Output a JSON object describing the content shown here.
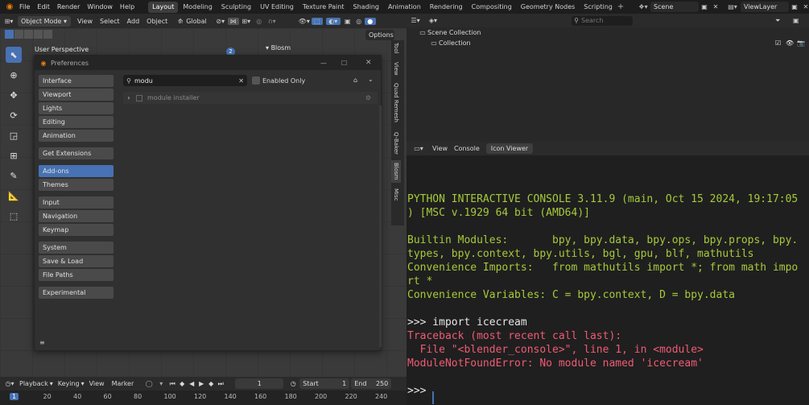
{
  "topbar": {
    "menus": [
      "File",
      "Edit",
      "Render",
      "Window",
      "Help"
    ],
    "workspaces": [
      "Layout",
      "Modeling",
      "Sculpting",
      "UV Editing",
      "Texture Paint",
      "Shading",
      "Animation",
      "Rendering",
      "Compositing",
      "Geometry Nodes",
      "Scripting"
    ],
    "scene": "Scene",
    "viewlayer": "ViewLayer"
  },
  "viewport": {
    "mode": "Object Mode",
    "menus": [
      "View",
      "Select",
      "Add",
      "Object"
    ],
    "orientation": "Global",
    "perspective": "User Perspective",
    "options": "Options",
    "blosm": "Blosm"
  },
  "prefs": {
    "title": "Preferences",
    "sidebar": [
      "Interface",
      "Viewport",
      "Lights",
      "Editing",
      "Animation",
      "Get Extensions",
      "Add-ons",
      "Themes",
      "Input",
      "Navigation",
      "Keymap",
      "System",
      "Save & Load",
      "File Paths",
      "Experimental"
    ],
    "active": "Add-ons",
    "search": "modu",
    "enabled_only": "Enabled Only",
    "addon": "module installer"
  },
  "sidetabs": [
    "Tool",
    "View",
    "Quad Remesh",
    "Q-Baker",
    "Blosm",
    "Misc"
  ],
  "timeline": {
    "playback": "Playback",
    "keying": "Keying",
    "view": "View",
    "marker": "Marker",
    "frame": "1",
    "start_label": "Start",
    "start": "1",
    "end_label": "End",
    "end": "250",
    "ticks": [
      "1",
      "20",
      "40",
      "60",
      "80",
      "100",
      "120",
      "140",
      "160",
      "180",
      "200",
      "220",
      "240"
    ]
  },
  "outliner": {
    "search_placeholder": "Search",
    "scene_collection": "Scene Collection",
    "collection": "Collection"
  },
  "console": {
    "menus": [
      "View",
      "Console"
    ],
    "tab": "Icon Viewer",
    "lines": [
      {
        "t": "PYTHON INTERACTIVE CONSOLE 3.11.9 (main, Oct 15 2024, 19:17:05",
        "c": "yel"
      },
      {
        "t": ") [MSC v.1929 64 bit (AMD64)]",
        "c": "yel"
      },
      {
        "t": "",
        "c": "yel"
      },
      {
        "t": "Builtin Modules:       bpy, bpy.data, bpy.ops, bpy.props, bpy.",
        "c": "yel"
      },
      {
        "t": "types, bpy.context, bpy.utils, bgl, gpu, blf, mathutils",
        "c": "yel"
      },
      {
        "t": "Convenience Imports:   from mathutils import *; from math impo",
        "c": "yel"
      },
      {
        "t": "rt *",
        "c": "yel"
      },
      {
        "t": "Convenience Variables: C = bpy.context, D = bpy.data",
        "c": "yel"
      },
      {
        "t": "",
        "c": "yel"
      },
      {
        "t": ">>> import icecream",
        "c": "wht"
      },
      {
        "t": "Traceback (most recent call last):",
        "c": "red"
      },
      {
        "t": "  File \"<blender_console>\", line 1, in <module>",
        "c": "red"
      },
      {
        "t": "ModuleNotFoundError: No module named 'icecream'",
        "c": "red"
      },
      {
        "t": "",
        "c": "wht"
      },
      {
        "t": ">>> ",
        "c": "wht"
      }
    ]
  },
  "colors": {
    "accent": "#4772b3",
    "console_yellow": "#a6c93a",
    "console_red": "#f05a74"
  }
}
